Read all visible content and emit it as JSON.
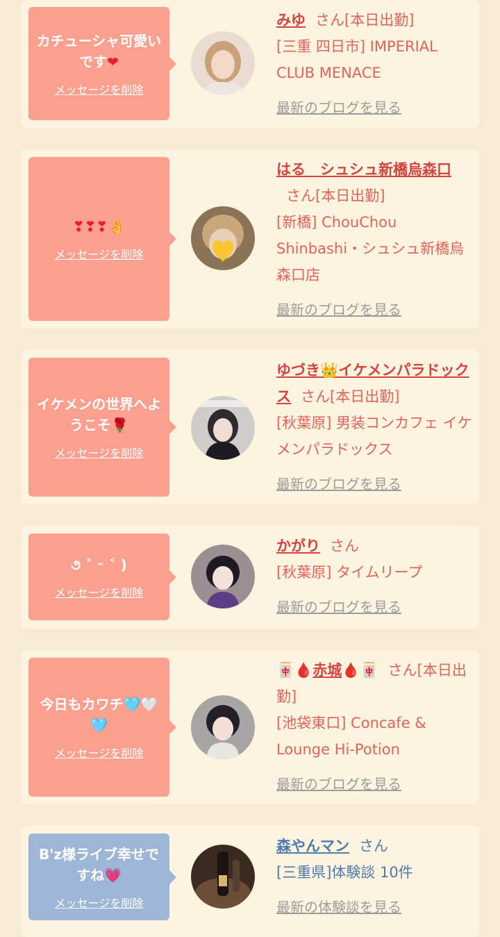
{
  "delete_label": "メッセージを削除",
  "cards": [
    {
      "message_text": "カチューシャ可愛いです",
      "message_emoji": "❤",
      "name": "みゆ",
      "suffix": "さん[本日出勤]",
      "shop": "[三重 四日市] IMPERIAL CLUB MENACE",
      "link": "最新のブログを見る"
    },
    {
      "message_text": "❣❣❣👌",
      "name": "はる　シュシュ新橋烏森口",
      "suffix": "さん[本日出勤]",
      "shop": "[新橋] ChouChou Shinbashi・シュシュ新橋烏森口店",
      "link": "最新のブログを見る"
    },
    {
      "message_text": "イケメンの世界へようこそ",
      "message_emoji": "🌹",
      "name_part1": "ゆづき",
      "name_emoji": "👑",
      "name_part2": "イケメンパラドックス",
      "suffix": "さん[本日出勤]",
      "shop": "[秋葉原] 男装コンカフェ イケメンパラドックス",
      "link": "最新のブログを見る"
    },
    {
      "message_text": "૭ ˃ ᵕ ˂ )",
      "name": "かがり",
      "suffix": "さん",
      "shop": "[秋葉原] タイムリープ",
      "link": "最新のブログを見る"
    },
    {
      "message_text": "今日もカワチ🩵🤍🩵",
      "name_pre": "🀄",
      "name_drop1": "🩸",
      "name": "赤城",
      "name_drop2": "🩸",
      "name_post": "🀄",
      "suffix": "さん[本日出勤]",
      "shop": "[池袋東口] Concafe & Lounge Hi-Potion",
      "link": "最新のブログを見る"
    },
    {
      "message_text": "B'z様ライブ幸せですね",
      "message_emoji": "💗",
      "name": "森やんマン",
      "suffix": "さん",
      "shop": "[三重県]体験談 10件",
      "link": "最新の体験談を見る"
    }
  ],
  "colors": {
    "page_bg": "#f7ebd3",
    "card_bg": "#fdf4e0",
    "bubble_pink": "#fb9f8f",
    "bubble_blue": "#9db6d6",
    "name_red": "#d4433f",
    "name_blue": "#4f79ac",
    "link_gray": "#9b9b9b"
  }
}
